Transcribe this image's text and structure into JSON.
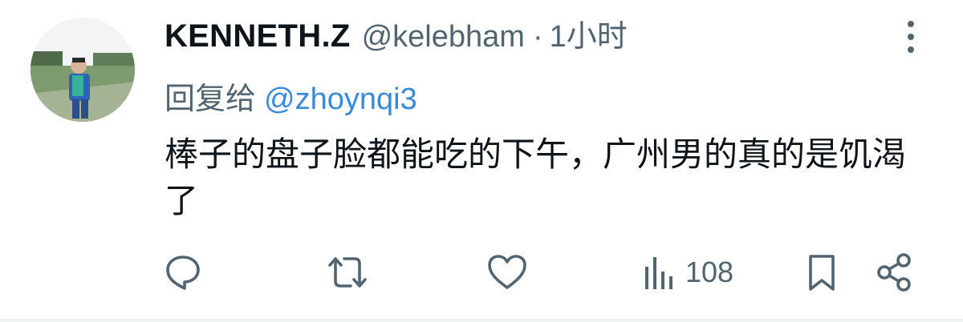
{
  "tweet": {
    "display_name": "KENNETH.Z",
    "handle": "@kelebham",
    "separator": "·",
    "timestamp": "1小时",
    "reply_prefix": "回复给",
    "reply_to": "@zhoynqi3",
    "text": "棒子的盘子脸都能吃的下午，广州男的真的是饥渴了"
  },
  "actions": {
    "reply_icon": "reply-icon",
    "retweet_icon": "retweet-icon",
    "like_icon": "heart-icon",
    "views_icon": "views-icon",
    "views_count": "108",
    "bookmark_icon": "bookmark-icon",
    "share_icon": "share-icon"
  },
  "colors": {
    "text": "#0f1419",
    "secondary": "#536471",
    "link": "#3b8ad9"
  }
}
